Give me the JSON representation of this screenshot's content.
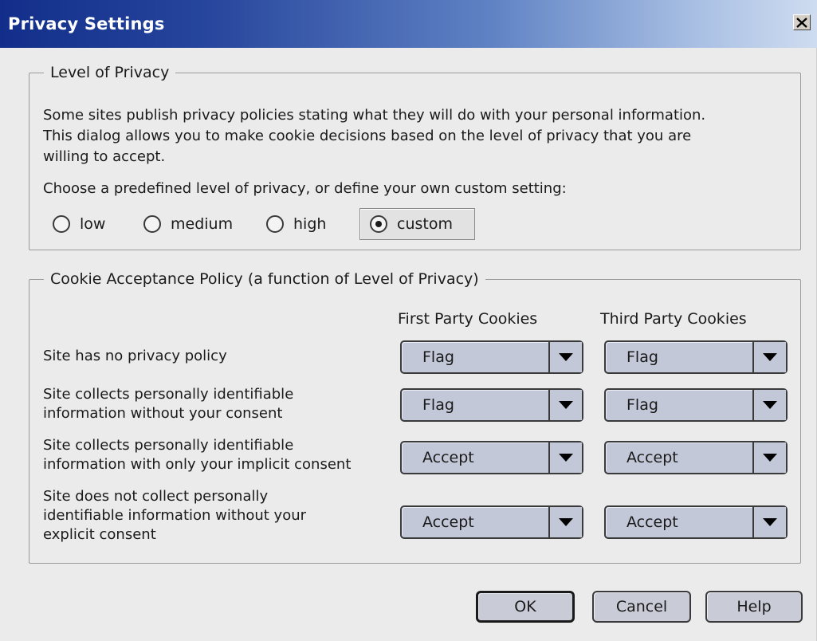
{
  "window": {
    "title": "Privacy Settings",
    "close_glyph": "X"
  },
  "privacy": {
    "legend": "Level of Privacy",
    "description": [
      "Some sites publish privacy policies stating what they will do with your personal information.",
      "This dialog allows you to make cookie decisions based on the level of privacy that you are",
      "willing to accept."
    ],
    "prompt": "Choose a predefined level of privacy, or define your own custom setting:",
    "options": [
      {
        "label": "low",
        "selected": false
      },
      {
        "label": "medium",
        "selected": false
      },
      {
        "label": "high",
        "selected": false
      },
      {
        "label": "custom",
        "selected": true
      }
    ]
  },
  "cookies": {
    "legend": "Cookie Acceptance Policy (a function of Level of Privacy)",
    "headers": {
      "first_party": "First Party Cookies",
      "third_party": "Third Party Cookies"
    },
    "rows": [
      {
        "label": [
          "Site has no privacy policy"
        ],
        "first": "Flag",
        "third": "Flag"
      },
      {
        "label": [
          "Site collects personally identifiable",
          "information without your consent"
        ],
        "first": "Flag",
        "third": "Flag"
      },
      {
        "label": [
          "Site collects personally identifiable",
          "information with only your implicit consent"
        ],
        "first": "Accept",
        "third": "Accept"
      },
      {
        "label": [
          "Site does not collect personally",
          "identifiable information without your",
          "explicit consent"
        ],
        "first": "Accept",
        "third": "Accept"
      }
    ]
  },
  "buttons": {
    "ok": "OK",
    "cancel": "Cancel",
    "help": "Help"
  },
  "icons": {
    "close": "close-icon",
    "dropdown": "chevron-down-icon"
  },
  "colors": {
    "titlebar_start": "#122e8a",
    "titlebar_end": "#cfdcf0",
    "dialog_bg": "#ebebeb",
    "control_bg": "#c3c8d8"
  }
}
